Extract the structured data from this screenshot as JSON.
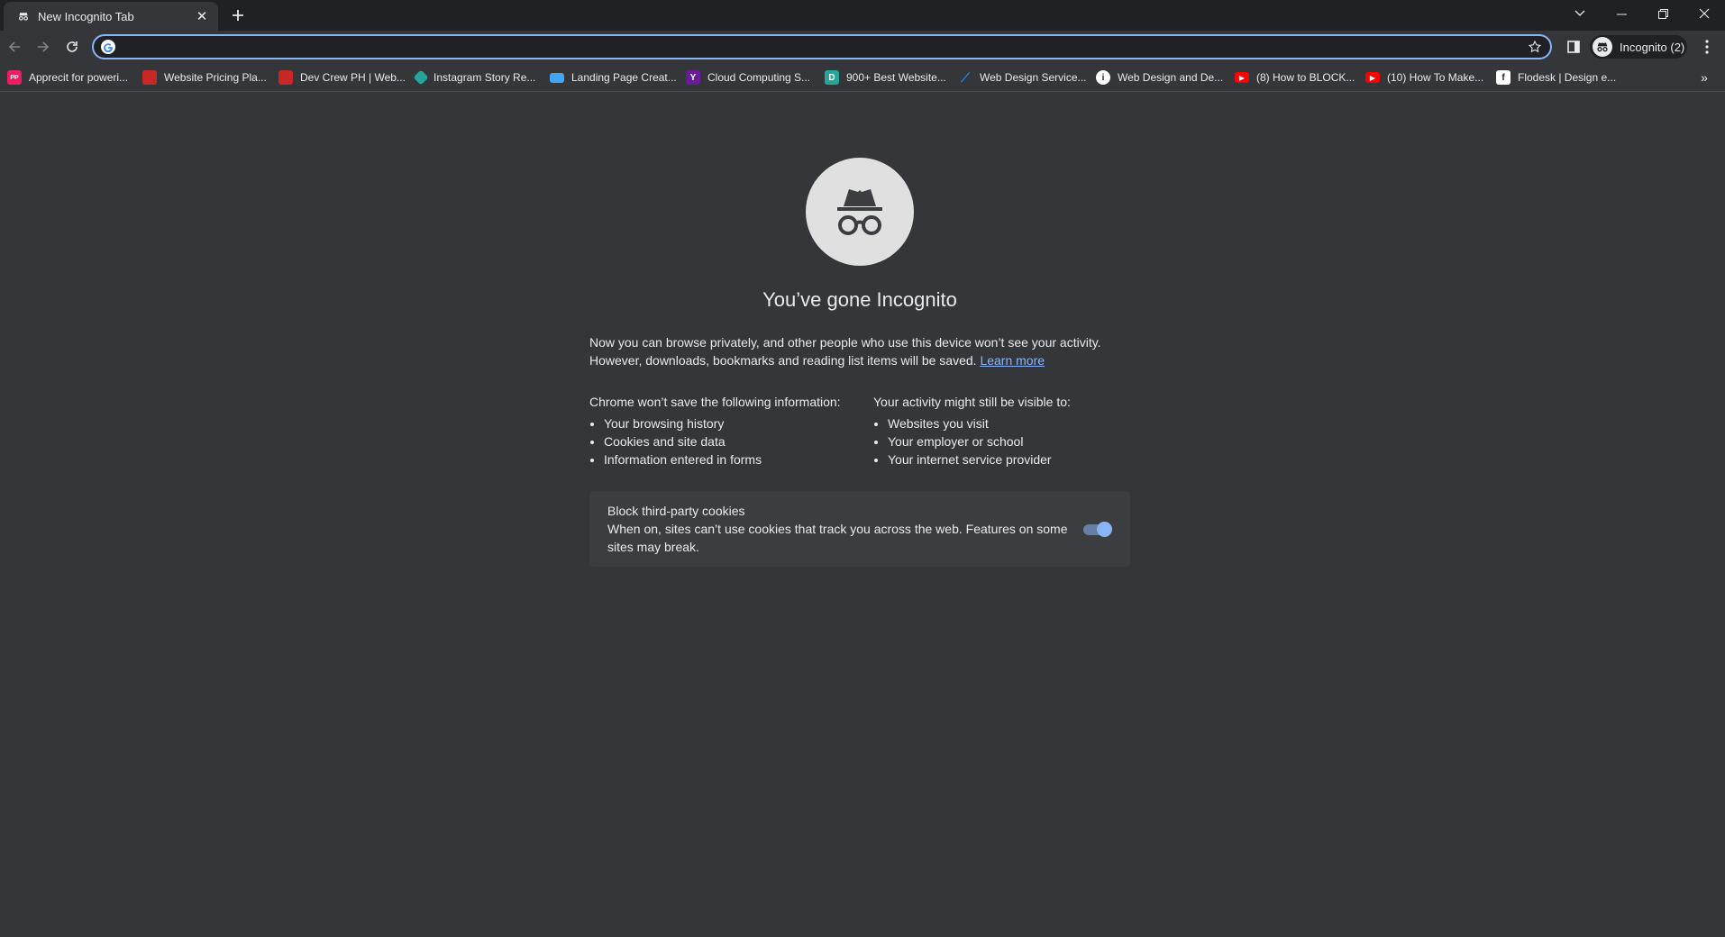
{
  "tab": {
    "title": "New Incognito Tab",
    "close_glyph": "✕",
    "icon": "incognito-icon"
  },
  "window_controls": {
    "tab_search": "tab-search-icon",
    "minimize": "minimize-icon",
    "restore": "restore-icon",
    "close": "close-icon"
  },
  "omnibox": {
    "value": "",
    "placeholder": ""
  },
  "profile": {
    "label": "Incognito (2)"
  },
  "bookmarks": [
    {
      "label": "Apprecit for poweri...",
      "color": "#e91e63",
      "glyph": "PP"
    },
    {
      "label": "Website Pricing Pla...",
      "color": "#c62828",
      "glyph": ""
    },
    {
      "label": "Dev Crew PH | Web...",
      "color": "#c62828",
      "glyph": ""
    },
    {
      "label": "Instagram Story Re...",
      "color": "#26a69a",
      "glyph": ""
    },
    {
      "label": "Landing Page Creat...",
      "color": "#42a5f5",
      "glyph": ""
    },
    {
      "label": "Cloud Computing S...",
      "color": "#6a1b9a",
      "glyph": "Y"
    },
    {
      "label": "900+ Best Website...",
      "color": "#26a69a",
      "glyph": "D"
    },
    {
      "label": "Web Design Service...",
      "color": "#1e88e5",
      "glyph": ""
    },
    {
      "label": "Web Design and De...",
      "color": "#ffffff",
      "glyph": "i"
    },
    {
      "label": "(8) How to BLOCK...",
      "color": "#ff0000",
      "glyph": "▶"
    },
    {
      "label": "(10) How To Make...",
      "color": "#ff0000",
      "glyph": "▶"
    },
    {
      "label": "Flodesk | Design e...",
      "color": "#ffffff",
      "glyph": "f"
    }
  ],
  "main": {
    "title": "You’ve gone Incognito",
    "intro_line1": "Now you can browse privately, and other people who use this device won’t see your activity.",
    "intro_line2": "However, downloads, bookmarks and reading list items will be saved.",
    "learn_more": "Learn more",
    "left_heading": "Chrome won’t save the following information:",
    "left_items": [
      "Your browsing history",
      "Cookies and site data",
      "Information entered in forms"
    ],
    "right_heading": "Your activity might still be visible to:",
    "right_items": [
      "Websites you visit",
      "Your employer or school",
      "Your internet service provider"
    ],
    "cookie_title": "Block third-party cookies",
    "cookie_desc": "When on, sites can’t use cookies that track you across the web. Features on some sites may break.",
    "cookie_toggle_on": true
  },
  "colors": {
    "accent": "#8ab4f8",
    "background": "#35363a",
    "frame": "#202124"
  }
}
